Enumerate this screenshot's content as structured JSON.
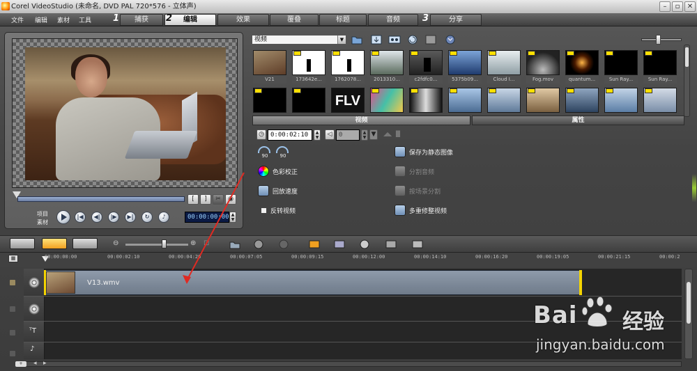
{
  "window": {
    "title": "Corel VideoStudio (未命名, DVD PAL 720*576 - 立体声)",
    "buttons": [
      "minimize",
      "restore",
      "close"
    ]
  },
  "menu": [
    "文件",
    "编辑",
    "素材",
    "工具"
  ],
  "steps": [
    {
      "num": "1",
      "label": "捕获",
      "active": false
    },
    {
      "num": "2",
      "label": "编辑",
      "active": true
    },
    {
      "num": "",
      "label": "效果",
      "active": false
    },
    {
      "num": "",
      "label": "覆叠",
      "active": false
    },
    {
      "num": "",
      "label": "标题",
      "active": false
    },
    {
      "num": "",
      "label": "音频",
      "active": false
    },
    {
      "num": "3",
      "label": "分享",
      "active": false
    }
  ],
  "preview": {
    "mode_project": "项目",
    "mode_clip": "素材",
    "timecode": "00:00:00:00",
    "mark_in": "[",
    "mark_out": "]",
    "scrub_position": 0
  },
  "library": {
    "category": "视频",
    "row1": [
      {
        "caption": "V21",
        "icon": "woman-laptop-thumb",
        "badge": false
      },
      {
        "caption": "173642e...",
        "icon": "silhouette-thumb",
        "badge": true
      },
      {
        "caption": "1762078...",
        "icon": "silhouette-thumb",
        "badge": true
      },
      {
        "caption": "2013310...",
        "icon": "landscape-thumb",
        "badge": true
      },
      {
        "caption": "c2fdfc0...",
        "icon": "dancer-thumb",
        "badge": true
      },
      {
        "caption": "5375b09...",
        "icon": "blue-scene-thumb",
        "badge": true
      },
      {
        "caption": "Cloud I...",
        "icon": "cloud-thumb",
        "badge": true
      },
      {
        "caption": "Fog.mov",
        "icon": "fog-thumb",
        "badge": true
      },
      {
        "caption": "quantum...",
        "icon": "flare-thumb",
        "badge": true
      },
      {
        "caption": "Sun Ray...",
        "icon": "sun-ray-thumb",
        "badge": true
      },
      {
        "caption": "Sun Ray...",
        "icon": "sun-ray-thumb",
        "badge": true
      }
    ],
    "row2": [
      {
        "icon": "black-thumb",
        "badge": true
      },
      {
        "icon": "black-thumb",
        "badge": true
      },
      {
        "icon": "flv-thumb",
        "label": "FLV",
        "badge": false
      },
      {
        "icon": "colorful-thumb",
        "badge": true
      },
      {
        "icon": "hallway-thumb",
        "badge": true
      },
      {
        "icon": "office-thumb",
        "badge": true
      },
      {
        "icon": "office-thumb",
        "badge": true
      },
      {
        "icon": "people-thumb",
        "badge": true
      },
      {
        "icon": "tv-thumb",
        "badge": true
      },
      {
        "icon": "office-thumb",
        "badge": true
      },
      {
        "icon": "office-thumb",
        "badge": true
      }
    ]
  },
  "options": {
    "tabs": [
      {
        "label": "视频",
        "active": true
      },
      {
        "label": "属性",
        "active": false
      }
    ],
    "duration": "0:00:02:10",
    "volume": "0",
    "rotate_left": "90",
    "rotate_right": "90",
    "color_correction": "色彩校正",
    "playback_speed": "回放速度",
    "reverse_video": "反转视频",
    "save_still": "保存为静态图像",
    "split_audio": "分割音频",
    "split_by_scene": "按场景分割",
    "multi_trim": "多重修整视频"
  },
  "timeline": {
    "ruler": [
      "00:00:00:00",
      "00:00:02:10",
      "00:00:04:20",
      "00:00:07:05",
      "00:00:09:15",
      "00:00:12:00",
      "00:00:14:10",
      "00:00:16:20",
      "00:00:19:05",
      "00:00:21:15",
      "00:00:2"
    ],
    "clip_name": "V13.wmv",
    "tracks": [
      "video",
      "overlay",
      "title",
      "audio"
    ]
  },
  "watermark": {
    "brand": "Bai",
    "cn": "经验",
    "url": "jingyan.baidu.com"
  },
  "colors": {
    "clip": "#7c8898",
    "active_tab": "#ffffff",
    "annotation_arrow": "#e02a22",
    "timecode_bg": "#0b1a44"
  }
}
